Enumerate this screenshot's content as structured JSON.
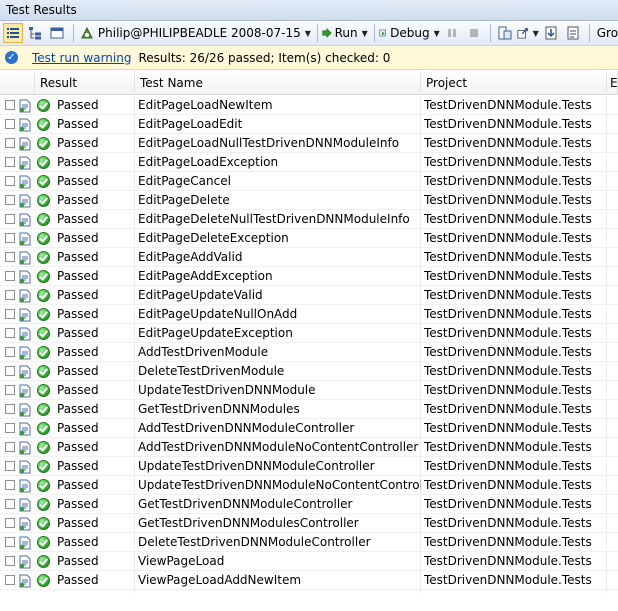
{
  "window": {
    "title": "Test Results"
  },
  "toolbar": {
    "run_config": "Philip@PHILIPBEADLE 2008-07-15",
    "run_label": "Run",
    "debug_label": "Debug",
    "group_label": "Gro"
  },
  "status": {
    "warning_link": "Test run warning",
    "summary": "Results: 26/26 passed;  Item(s) checked: 0"
  },
  "columns": {
    "result": "Result",
    "test_name": "Test Name",
    "project": "Project",
    "error": "Er"
  },
  "rows": [
    {
      "result": "Passed",
      "name": "EditPageLoadNewItem",
      "project": "TestDrivenDNNModule.Tests"
    },
    {
      "result": "Passed",
      "name": "EditPageLoadEdit",
      "project": "TestDrivenDNNModule.Tests"
    },
    {
      "result": "Passed",
      "name": "EditPageLoadNullTestDrivenDNNModuleInfo",
      "project": "TestDrivenDNNModule.Tests"
    },
    {
      "result": "Passed",
      "name": "EditPageLoadException",
      "project": "TestDrivenDNNModule.Tests"
    },
    {
      "result": "Passed",
      "name": "EditPageCancel",
      "project": "TestDrivenDNNModule.Tests"
    },
    {
      "result": "Passed",
      "name": "EditPageDelete",
      "project": "TestDrivenDNNModule.Tests"
    },
    {
      "result": "Passed",
      "name": "EditPageDeleteNullTestDrivenDNNModuleInfo",
      "project": "TestDrivenDNNModule.Tests"
    },
    {
      "result": "Passed",
      "name": "EditPageDeleteException",
      "project": "TestDrivenDNNModule.Tests"
    },
    {
      "result": "Passed",
      "name": "EditPageAddValid",
      "project": "TestDrivenDNNModule.Tests"
    },
    {
      "result": "Passed",
      "name": "EditPageAddException",
      "project": "TestDrivenDNNModule.Tests"
    },
    {
      "result": "Passed",
      "name": "EditPageUpdateValid",
      "project": "TestDrivenDNNModule.Tests"
    },
    {
      "result": "Passed",
      "name": "EditPageUpdateNullOnAdd",
      "project": "TestDrivenDNNModule.Tests"
    },
    {
      "result": "Passed",
      "name": "EditPageUpdateException",
      "project": "TestDrivenDNNModule.Tests"
    },
    {
      "result": "Passed",
      "name": "AddTestDrivenModule",
      "project": "TestDrivenDNNModule.Tests"
    },
    {
      "result": "Passed",
      "name": "DeleteTestDrivenModule",
      "project": "TestDrivenDNNModule.Tests"
    },
    {
      "result": "Passed",
      "name": "UpdateTestDrivenDNNModule",
      "project": "TestDrivenDNNModule.Tests"
    },
    {
      "result": "Passed",
      "name": "GetTestDrivenDNNModules",
      "project": "TestDrivenDNNModule.Tests"
    },
    {
      "result": "Passed",
      "name": "AddTestDrivenDNNModuleController",
      "project": "TestDrivenDNNModule.Tests"
    },
    {
      "result": "Passed",
      "name": "AddTestDrivenDNNModuleNoContentController",
      "project": "TestDrivenDNNModule.Tests"
    },
    {
      "result": "Passed",
      "name": "UpdateTestDrivenDNNModuleController",
      "project": "TestDrivenDNNModule.Tests"
    },
    {
      "result": "Passed",
      "name": "UpdateTestDrivenDNNModuleNoContentController",
      "project": "TestDrivenDNNModule.Tests"
    },
    {
      "result": "Passed",
      "name": "GetTestDrivenDNNModuleController",
      "project": "TestDrivenDNNModule.Tests"
    },
    {
      "result": "Passed",
      "name": "GetTestDrivenDNNModulesController",
      "project": "TestDrivenDNNModule.Tests"
    },
    {
      "result": "Passed",
      "name": "DeleteTestDrivenDNNModuleController",
      "project": "TestDrivenDNNModule.Tests"
    },
    {
      "result": "Passed",
      "name": "ViewPageLoad",
      "project": "TestDrivenDNNModule.Tests"
    },
    {
      "result": "Passed",
      "name": "ViewPageLoadAddNewItem",
      "project": "TestDrivenDNNModule.Tests"
    }
  ]
}
